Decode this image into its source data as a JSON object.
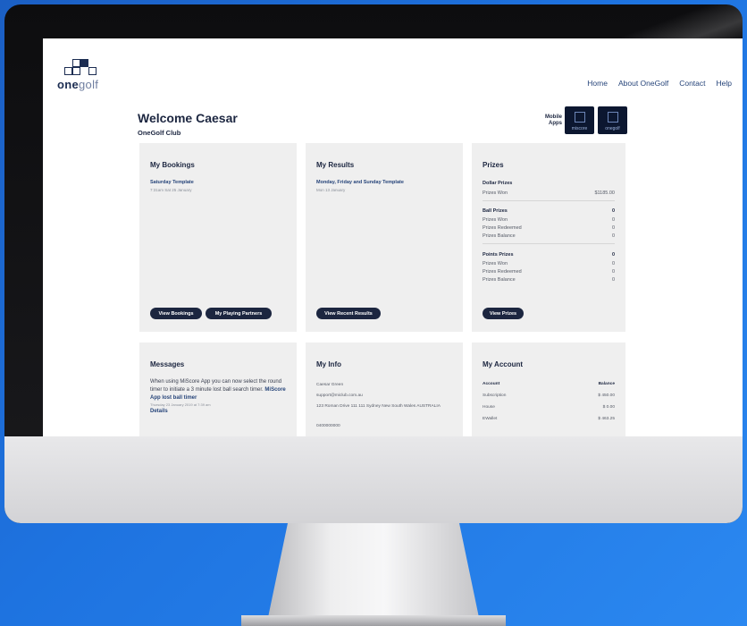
{
  "nav": {
    "home": "Home",
    "about": "About OneGolf",
    "contact": "Contact",
    "help": "Help"
  },
  "logo": {
    "bold": "one",
    "light": "golf"
  },
  "welcome": {
    "title": "Welcome Caesar",
    "club": "OneGolf Club"
  },
  "mobile_apps": {
    "label_line1": "Mobile",
    "label_line2": "Apps",
    "app1": "miscore",
    "app2": "onegolf"
  },
  "bookings": {
    "title": "My Bookings",
    "item_title": "Saturday Template",
    "item_sub": "7:31am Sat 25 January",
    "btn_view": "View Bookings",
    "btn_partners": "My Playing Partners"
  },
  "results": {
    "title": "My Results",
    "item_title": "Monday, Friday and Sunday Template",
    "item_sub": "Mon 13 January",
    "btn_view": "View Recent Results"
  },
  "prizes": {
    "title": "Prizes",
    "dollar_head": "Dollar Prizes",
    "dollar_won_label": "Prizes Won",
    "dollar_won_value": "$1185.00",
    "ball_head": "Ball Prizes",
    "ball_head_value": "0",
    "ball_won_label": "Prizes Won",
    "ball_won_value": "0",
    "ball_redeemed_label": "Prizes Redeemed",
    "ball_redeemed_value": "0",
    "ball_balance_label": "Prizes Balance",
    "ball_balance_value": "0",
    "points_head": "Points Prizes",
    "points_head_value": "0",
    "points_won_label": "Prizes Won",
    "points_won_value": "0",
    "points_redeemed_label": "Prizes Redeemed",
    "points_redeemed_value": "0",
    "points_balance_label": "Prizes Balance",
    "points_balance_value": "0",
    "btn_view": "View Prizes"
  },
  "messages": {
    "title": "Messages",
    "line1": "When using MiScore App you can now select the round timer to initiate a 3 minute lost ball search timer.",
    "link": "MiScore App lost ball timer",
    "date": "Thursday 23 January 2019 at 7:39 am",
    "details": "Details"
  },
  "info": {
    "title": "My Info",
    "name": "Caesar Green",
    "email": "support@miclub.com.au",
    "address": "123 Roman Drive 111 111 Sydney New South Wales AUSTRALIA",
    "phone": "0400000000"
  },
  "account": {
    "title": "My Account",
    "col_account": "Account",
    "col_balance": "Balance",
    "rows": [
      {
        "name": "Subscription",
        "balance": "$ 450.00"
      },
      {
        "name": "House",
        "balance": "$ 0.00"
      },
      {
        "name": "EWallet",
        "balance": "$ 463.25"
      }
    ]
  }
}
